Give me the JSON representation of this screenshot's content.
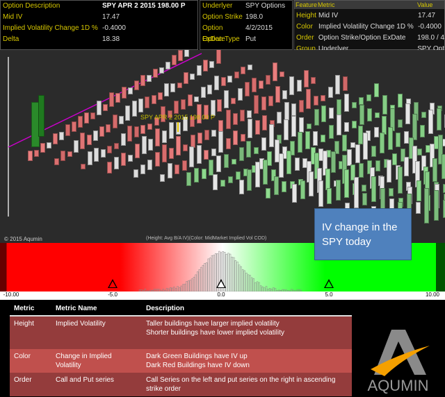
{
  "info": {
    "rows": [
      {
        "label": "Option Description",
        "value": "SPY APR 2 2015 198.00 P"
      },
      {
        "label": "Mid IV",
        "value": "17.47"
      },
      {
        "label": "Implied Volatility Change 1D %",
        "value": "-0.4000"
      },
      {
        "label": "Delta",
        "value": "18.38"
      }
    ]
  },
  "option": {
    "rows": [
      {
        "label": "Underlyer",
        "value": "SPY Options"
      },
      {
        "label": "Option Strike",
        "value": "198.0"
      },
      {
        "label": "Option ExDate",
        "value": "4/2/2015"
      },
      {
        "label": "Option Type",
        "value": "Put"
      }
    ]
  },
  "features": {
    "headers": [
      "Feature",
      "Metric",
      "Value"
    ],
    "rows": [
      {
        "feature": "Height",
        "metric": "Mid IV",
        "value": "17.47"
      },
      {
        "feature": "Color",
        "metric": "Implied Volatility Change 1D %",
        "value": "-0.4000"
      },
      {
        "feature": "Order",
        "metric": "Option Strike/Option ExDate",
        "value": "198.0 / 4"
      },
      {
        "feature": "Group",
        "metric": "Underlyer",
        "value": "SPY Opt"
      }
    ]
  },
  "scene": {
    "selected_label": "SPY APR 2 2015 198.00 P",
    "copyright": "© 2015 Aqumin",
    "legend": "(Height: Avg B/A IV)(Color: MidMarket Implied Vol COD)"
  },
  "callout": "IV change in the SPY today",
  "scale": {
    "ticks": [
      "-10.00",
      "-5.0",
      "0.0",
      "5.0",
      "10.00"
    ],
    "colors": {
      "neg": "#ff0000",
      "mid": "#ffffff",
      "pos": "#00ff00"
    }
  },
  "table": {
    "headers": [
      "Metric",
      "Metric Name",
      "Description"
    ],
    "rows": [
      {
        "metric": "Height",
        "name": "Implied Volatility",
        "desc": [
          "Taller buildings have larger implied volatility",
          "Shorter buildings have lower implied volatility"
        ]
      },
      {
        "metric": "Color",
        "name": "Change in Implied Volatility",
        "desc": [
          "Dark Green Buildings have IV up",
          "Dark Red Buildings have IV down"
        ]
      },
      {
        "metric": "Order",
        "name": "Call and Put series",
        "desc": [
          "Call Series on the left and put series on the right in ascending strike order"
        ]
      }
    ]
  },
  "logo": "AQUMIN"
}
